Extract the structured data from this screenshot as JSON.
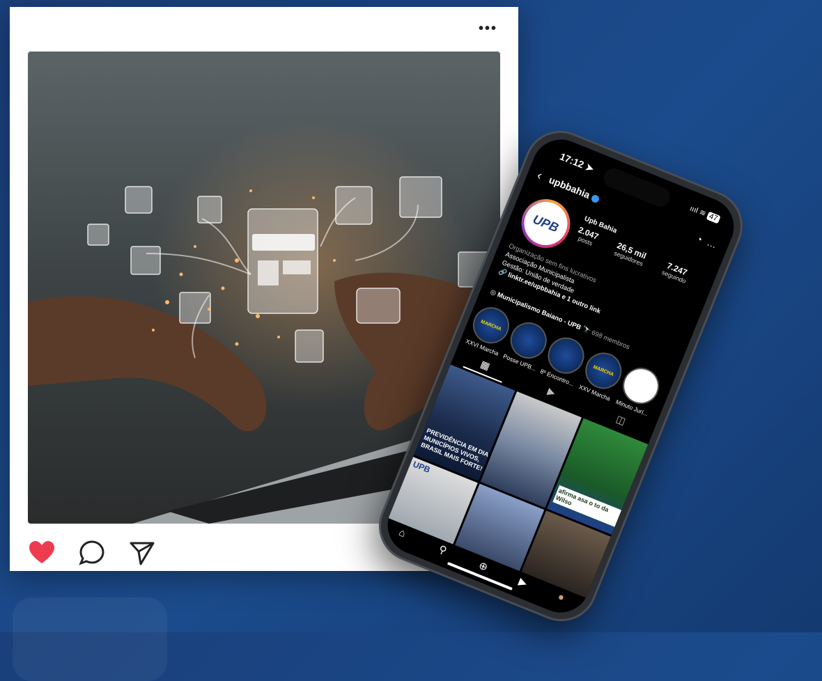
{
  "post": {
    "more_label": "•••",
    "icons": [
      "heart-icon",
      "comment-icon",
      "share-icon"
    ],
    "like_color": "#ed3c50"
  },
  "phone": {
    "status": {
      "time": "17:12 ➤",
      "signal": "ıııl",
      "battery": "47"
    },
    "header": {
      "back": "‹",
      "username": "upbbahia",
      "bell": "🔔",
      "more": "…"
    },
    "profile": {
      "name": "Upb Bahia",
      "posts_count": "2.047",
      "posts_label": "posts",
      "followers_count": "26,5 mil",
      "followers_label": "seguidores",
      "following_count": "7.247",
      "following_label": "seguindo",
      "category": "Organização sem fins lucrativos",
      "bio_line1": "Associação Municipalista",
      "bio_line2": "Gestão: União de verdade",
      "link": "🔗 linktr.ee/upbbahia e 1 outro link",
      "group_name": "Municipalismo Baiano - UPB 🔭",
      "group_members": "698 membros",
      "avatar_text": "UPB"
    },
    "highlights": [
      {
        "label": "XXVI Marcha",
        "inner": "MARCHA"
      },
      {
        "label": "Posse UPB...",
        "inner": ""
      },
      {
        "label": "8º Encontro...",
        "inner": ""
      },
      {
        "label": "XXV Marcha",
        "inner": "MARCHA"
      },
      {
        "label": "Minuto Jurí...",
        "inner": ""
      }
    ],
    "grid_tiles": [
      {
        "text": "PREVIDÊNCIA EM DIA MUNICÍPIOS VIVOS, BRASIL MAIS FORTE!"
      },
      {
        "text": ""
      },
      {
        "text": "afirma asa o to da Wilso"
      },
      {
        "text": "UPB"
      },
      {
        "text": ""
      },
      {
        "text": ""
      }
    ],
    "nav": [
      "⌂",
      "⚲",
      "⊕",
      "▶",
      "●"
    ],
    "colors": {
      "verified": "#3897f0",
      "upb_blue": "#1f3f8a",
      "upb_yellow": "#ffd800"
    }
  }
}
